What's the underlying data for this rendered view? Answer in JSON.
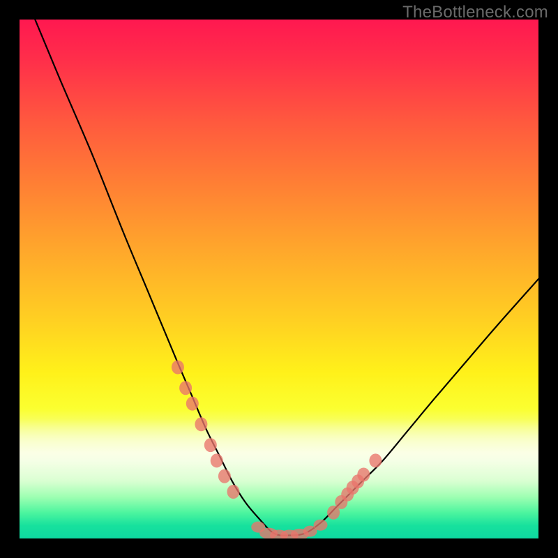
{
  "watermark": "TheBottleneck.com",
  "chart_data": {
    "type": "line",
    "title": "",
    "xlabel": "",
    "ylabel": "",
    "xlim": [
      0,
      100
    ],
    "ylim": [
      0,
      100
    ],
    "series": [
      {
        "name": "bottleneck-curve",
        "x": [
          3,
          8,
          14,
          20,
          25,
          30,
          33,
          36,
          38.5,
          41,
          43.5,
          46,
          49,
          52,
          55,
          58,
          61,
          63,
          66,
          70,
          75,
          80,
          86,
          92,
          100
        ],
        "y": [
          100,
          88,
          74,
          59,
          47,
          35,
          28,
          21,
          16,
          11,
          7,
          4,
          1,
          0.6,
          1,
          3,
          6,
          8,
          11,
          15,
          21,
          27,
          34,
          41,
          50
        ]
      }
    ],
    "markers": {
      "left_cluster": [
        {
          "x": 30.5,
          "y": 33
        },
        {
          "x": 32.0,
          "y": 29
        },
        {
          "x": 33.3,
          "y": 26
        },
        {
          "x": 35.0,
          "y": 22
        },
        {
          "x": 36.8,
          "y": 18
        },
        {
          "x": 38.0,
          "y": 15
        },
        {
          "x": 39.5,
          "y": 12
        },
        {
          "x": 41.2,
          "y": 9
        }
      ],
      "bottom_cluster": [
        {
          "x": 46.0,
          "y": 2.2
        },
        {
          "x": 48.0,
          "y": 1.0
        },
        {
          "x": 50.0,
          "y": 0.6
        },
        {
          "x": 52.0,
          "y": 0.6
        },
        {
          "x": 54.0,
          "y": 0.8
        },
        {
          "x": 56.0,
          "y": 1.4
        },
        {
          "x": 58.0,
          "y": 2.6
        }
      ],
      "right_cluster": [
        {
          "x": 60.5,
          "y": 5.0
        },
        {
          "x": 62.0,
          "y": 7.0
        },
        {
          "x": 63.2,
          "y": 8.5
        },
        {
          "x": 64.2,
          "y": 9.8
        },
        {
          "x": 65.2,
          "y": 11.0
        },
        {
          "x": 66.3,
          "y": 12.3
        },
        {
          "x": 68.6,
          "y": 15.0
        }
      ]
    },
    "gradient_stops": [
      {
        "pos": 0.0,
        "color": "#ff1850"
      },
      {
        "pos": 0.45,
        "color": "#ffa92b"
      },
      {
        "pos": 0.75,
        "color": "#fbff30"
      },
      {
        "pos": 0.92,
        "color": "#9effb2"
      },
      {
        "pos": 1.0,
        "color": "#0ed9a1"
      }
    ]
  }
}
